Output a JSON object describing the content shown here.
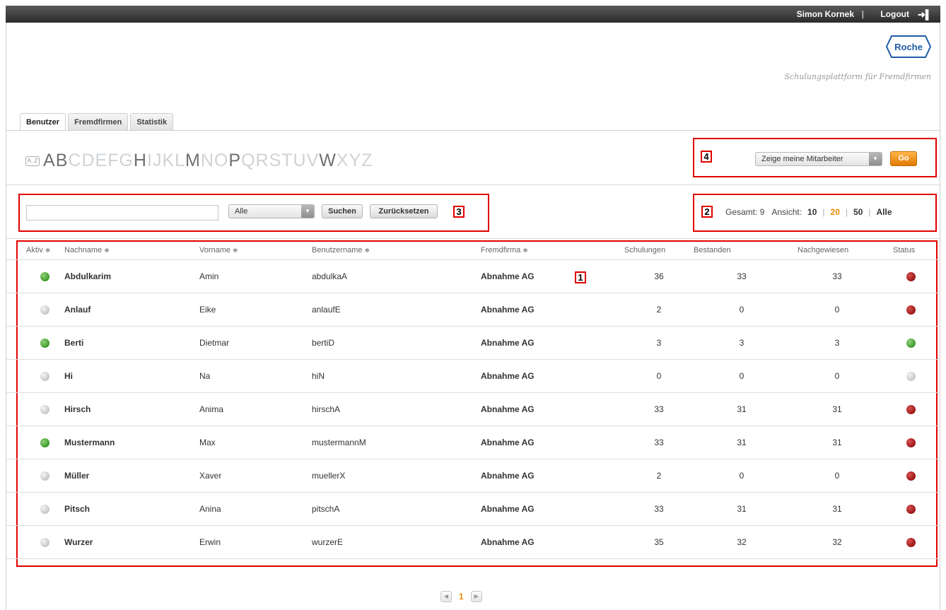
{
  "topbar": {
    "user_name": "Simon Kornek",
    "separator": "|",
    "logout_label": "Logout"
  },
  "brand": {
    "logo_text": "Roche",
    "tagline": "Schulungsplattform für Fremdfirmen"
  },
  "tabs": [
    {
      "label": "Benutzer",
      "active": true
    },
    {
      "label": "Fremdfirmen",
      "active": false
    },
    {
      "label": "Statistik",
      "active": false
    }
  ],
  "alphabet": {
    "icon_text": "A..Z",
    "letters": [
      "A",
      "B",
      "C",
      "D",
      "E",
      "F",
      "G",
      "H",
      "I",
      "J",
      "K",
      "L",
      "M",
      "N",
      "O",
      "P",
      "Q",
      "R",
      "S",
      "T",
      "U",
      "V",
      "W",
      "X",
      "Y",
      "Z"
    ],
    "active_letters": [
      "A",
      "B",
      "H",
      "M",
      "P",
      "W"
    ]
  },
  "filter": {
    "employee_select": "Zeige meine Mitarbeiter",
    "go_label": "Go"
  },
  "search": {
    "input_value": "",
    "scope_select": "Alle",
    "search_label": "Suchen",
    "reset_label": "Zurücksetzen"
  },
  "counts": {
    "total_label": "Gesamt: 9",
    "view_label": "Ansicht:",
    "options": [
      "10",
      "20",
      "50",
      "Alle"
    ],
    "current": "20"
  },
  "annotations": [
    "1",
    "2",
    "3",
    "4"
  ],
  "table": {
    "headers": {
      "aktiv": "Aktiv",
      "nachname": "Nachname",
      "vorname": "Vorname",
      "benutzername": "Benutzername",
      "fremdfirma": "Fremdfirma",
      "schulungen": "Schulungen",
      "bestanden": "Bestanden",
      "nachgewiesen": "Nachgewiesen",
      "status": "Status"
    },
    "rows": [
      {
        "aktiv": "green",
        "nachname": "Abdulkarim",
        "vorname": "Amin",
        "benutzername": "abdulkaA",
        "fremdfirma": "Abnahme AG",
        "schulungen": "36",
        "bestanden": "33",
        "nachgewiesen": "33",
        "status": "red"
      },
      {
        "aktiv": "grey",
        "nachname": "Anlauf",
        "vorname": "Eike",
        "benutzername": "anlaufE",
        "fremdfirma": "Abnahme AG",
        "schulungen": "2",
        "bestanden": "0",
        "nachgewiesen": "0",
        "status": "red"
      },
      {
        "aktiv": "green",
        "nachname": "Berti",
        "vorname": "Dietmar",
        "benutzername": "bertiD",
        "fremdfirma": "Abnahme AG",
        "schulungen": "3",
        "bestanden": "3",
        "nachgewiesen": "3",
        "status": "green"
      },
      {
        "aktiv": "grey",
        "nachname": "Hi",
        "vorname": "Na",
        "benutzername": "hiN",
        "fremdfirma": "Abnahme AG",
        "schulungen": "0",
        "bestanden": "0",
        "nachgewiesen": "0",
        "status": "grey"
      },
      {
        "aktiv": "grey",
        "nachname": "Hirsch",
        "vorname": "Anima",
        "benutzername": "hirschA",
        "fremdfirma": "Abnahme AG",
        "schulungen": "33",
        "bestanden": "31",
        "nachgewiesen": "31",
        "status": "red"
      },
      {
        "aktiv": "green",
        "nachname": "Mustermann",
        "vorname": "Max",
        "benutzername": "mustermannM",
        "fremdfirma": "Abnahme AG",
        "schulungen": "33",
        "bestanden": "31",
        "nachgewiesen": "31",
        "status": "red"
      },
      {
        "aktiv": "grey",
        "nachname": "Müller",
        "vorname": "Xaver",
        "benutzername": "muellerX",
        "fremdfirma": "Abnahme AG",
        "schulungen": "2",
        "bestanden": "0",
        "nachgewiesen": "0",
        "status": "red"
      },
      {
        "aktiv": "grey",
        "nachname": "Pitsch",
        "vorname": "Anina",
        "benutzername": "pitschA",
        "fremdfirma": "Abnahme AG",
        "schulungen": "33",
        "bestanden": "31",
        "nachgewiesen": "31",
        "status": "red"
      },
      {
        "aktiv": "grey",
        "nachname": "Wurzer",
        "vorname": "Erwin",
        "benutzername": "wurzerE",
        "fremdfirma": "Abnahme AG",
        "schulungen": "35",
        "bestanden": "32",
        "nachgewiesen": "32",
        "status": "red"
      }
    ]
  },
  "pager": {
    "prev_icon": "chevron-left-icon",
    "next_icon": "chevron-right-icon",
    "current_page": "1"
  },
  "colors": {
    "accent": "#f08a00",
    "annotation": "#e00000",
    "active_green": "#3f9a2a",
    "status_red": "#9a1616"
  }
}
